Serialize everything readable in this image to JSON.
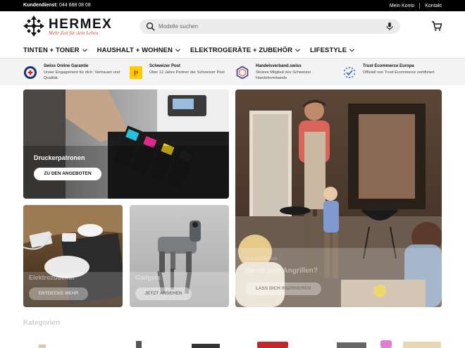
{
  "topbar": {
    "service_label": "Kundendienst:",
    "service_phone": "044 688 08 08",
    "account_link": "Mein Konto",
    "contact_link": "Kontakt"
  },
  "header": {
    "brand": "HERMEX",
    "slogan": "Mehr Zeit für dein Leben",
    "search_placeholder": "Modelle suchen"
  },
  "nav": [
    {
      "label": "TINTEN + TONER"
    },
    {
      "label": "HAUSHALT + WOHNEN"
    },
    {
      "label": "ELEKTROGERÄTE + ZUBEHÖR"
    },
    {
      "label": "LIFESTYLE"
    }
  ],
  "trust": [
    {
      "title": "Swiss Online Garantie",
      "text": "Unser Engagement für dich: Vertrauen und Qualität.",
      "icon": "swiss-online-guarantee-icon"
    },
    {
      "title": "Schweizer Post",
      "text": "Über 12 Jahre Partner der Schweizer Post",
      "icon": "swiss-post-icon"
    },
    {
      "title": "Handelsverband.swiss",
      "text": "Stolzes Mitglied des Schweizer Handelsverbands",
      "icon": "handelsverband-icon"
    },
    {
      "title": "Trust Ecommerce Europa",
      "text": "Offiziell von Trust Ecommerce zertifiziert",
      "icon": "trust-ecommerce-icon"
    }
  ],
  "cards": {
    "printer": {
      "title": "Druckerpatronen",
      "button": "ZU DEN ANGEBOTEN"
    },
    "electronics": {
      "title": "Elektrozubehör",
      "button": "ENTDECKE MEHR"
    },
    "robot": {
      "title": "Gadgets",
      "button": "JETZT ANSEHEN"
    },
    "grill": {
      "subtitle": "Outdoor-Saison",
      "title": "Bereit zum Angrillen?",
      "button": "LASS DICH INSPIRIEREN"
    }
  },
  "sections": {
    "categories_title": "Kategorien"
  },
  "colors": {
    "accent": "#d8492b",
    "topbar": "#000000",
    "trust_bg": "#f3f3f3"
  }
}
